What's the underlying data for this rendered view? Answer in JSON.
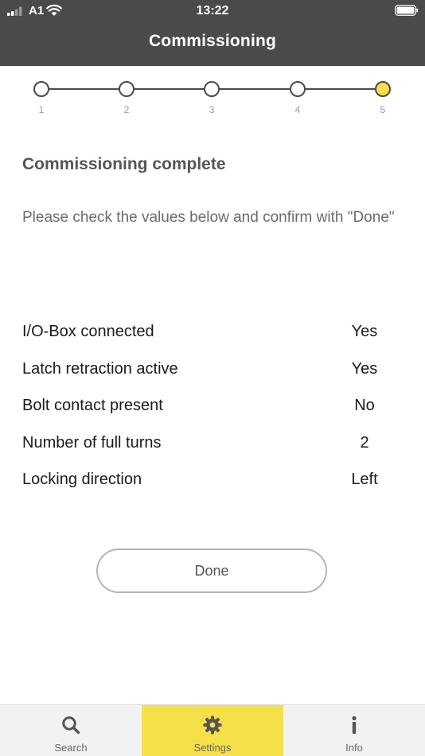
{
  "status_bar": {
    "carrier": "A1",
    "time": "13:22"
  },
  "header": {
    "title": "Commissioning"
  },
  "stepper": {
    "steps": [
      "1",
      "2",
      "3",
      "4",
      "5"
    ],
    "current_step": 5
  },
  "content": {
    "heading": "Commissioning complete",
    "instructions": "Please check the values below and confirm with \"Done\"",
    "rows": [
      {
        "label": "I/O-Box connected",
        "value": "Yes"
      },
      {
        "label": "Latch retraction active",
        "value": "Yes"
      },
      {
        "label": "Bolt contact present",
        "value": "No"
      },
      {
        "label": "Number of full turns",
        "value": "2"
      },
      {
        "label": "Locking direction",
        "value": "Left"
      }
    ],
    "done_label": "Done"
  },
  "tabbar": {
    "tabs": [
      {
        "label": "Search",
        "icon": "search-icon"
      },
      {
        "label": "Settings",
        "icon": "gear-icon",
        "active": true
      },
      {
        "label": "Info",
        "icon": "info-icon"
      }
    ]
  },
  "colors": {
    "header": "#4a4a4a",
    "accent": "#f5e04a",
    "tab_bg": "#f2f2f2"
  }
}
